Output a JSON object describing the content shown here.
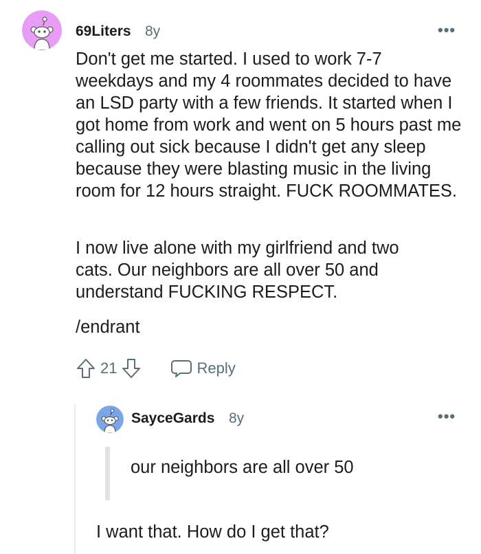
{
  "comment": {
    "username": "69Liters",
    "time": "8y",
    "paragraphs": [
      "Don't get me started. I used to work 7-7 weekdays and my 4 roommates decided to have an LSD party with a few friends. It started when I got home from work and went on 5 hours past me calling out sick because I didn't get any sleep because they were blasting music in the living room for 12 hours straight. FUCK ROOMMATES.",
      "I now live alone with my girlfriend and two cats. Our neighbors are all over 50 and understand FUCKING RESPECT.",
      "/endrant"
    ],
    "score": "21",
    "reply_label": "Reply",
    "more_label": "•••",
    "avatar_color": "#e79cf5"
  },
  "reply": {
    "username": "SayceGards",
    "time": "8y",
    "quote": "our neighbors are all over 50",
    "text": "I want that. How do I get that?",
    "more_label": "•••",
    "avatar_color": "#7aa6e8"
  }
}
